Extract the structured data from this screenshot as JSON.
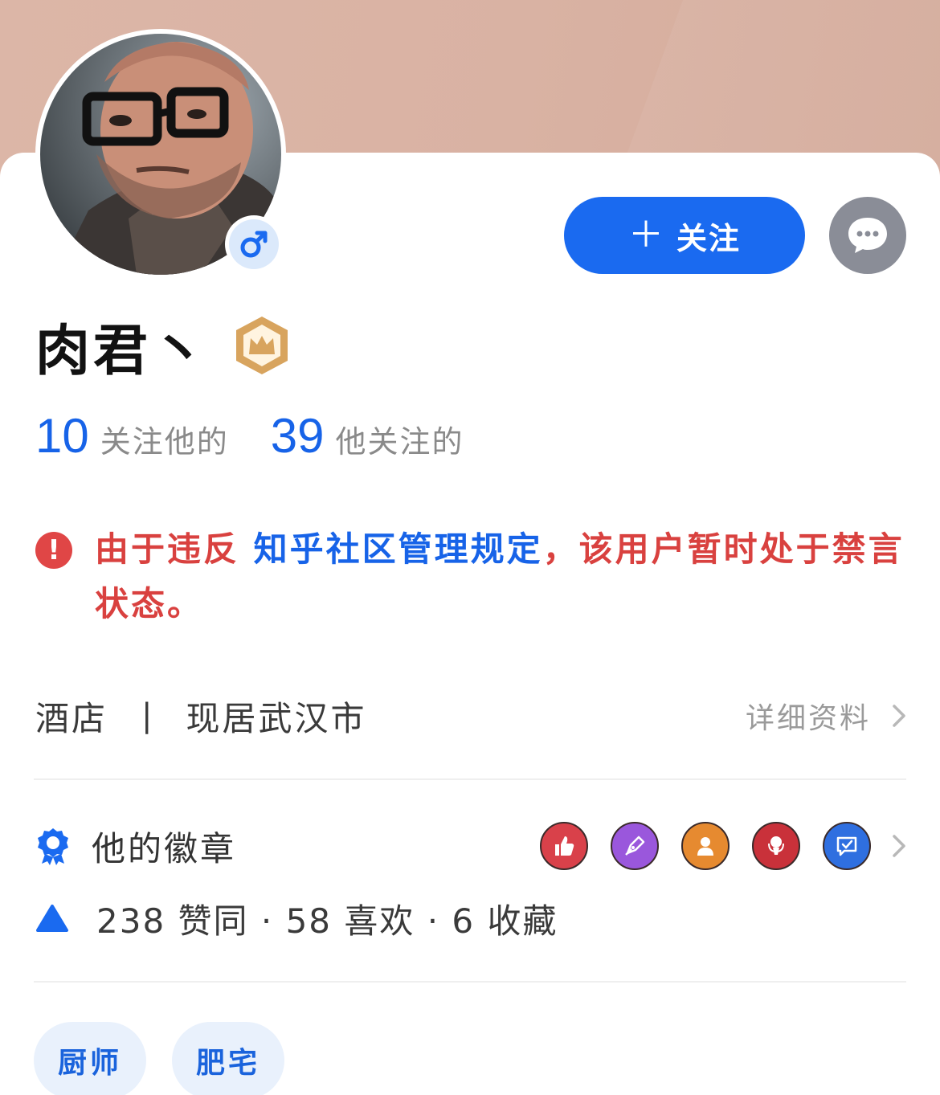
{
  "profile": {
    "username": "肉君丶",
    "follow_button_label": "关注",
    "follow_button_icon": "plus-icon",
    "message_button_icon": "chat-bubble-icon",
    "gender_icon": "male-icon",
    "level_icon": "crown-hexagon-icon"
  },
  "stats": {
    "followers_count": "10",
    "followers_label": "关注他的",
    "following_count": "39",
    "following_label": "他关注的"
  },
  "notice": {
    "prefix": "由于违反",
    "link": "知乎社区管理规定",
    "suffix": "，该用户暂时处于禁言状态。"
  },
  "info": {
    "occupation": "酒店",
    "separator": "|",
    "location": "现居武汉市",
    "detail_link": "详细资料"
  },
  "badges": {
    "title": "他的徽章",
    "title_icon": "medal-icon",
    "items": [
      {
        "icon": "thumbs-up-badge-icon",
        "color": "#d9414a"
      },
      {
        "icon": "pen-badge-icon",
        "color": "#9a57dc"
      },
      {
        "icon": "person-badge-icon",
        "color": "#e68a30"
      },
      {
        "icon": "microphone-badge-icon",
        "color": "#c9313a"
      },
      {
        "icon": "message-check-badge-icon",
        "color": "#2f6fe0"
      }
    ]
  },
  "engagement": {
    "icon": "triangle-up-icon",
    "text": "238 赞同 · 58 喜欢 · 6 收藏"
  },
  "tags": [
    "厨师",
    "肥宅"
  ],
  "colors": {
    "accent": "#1a6af0",
    "warning": "#d9413f",
    "cover": "#dcb6a7"
  }
}
